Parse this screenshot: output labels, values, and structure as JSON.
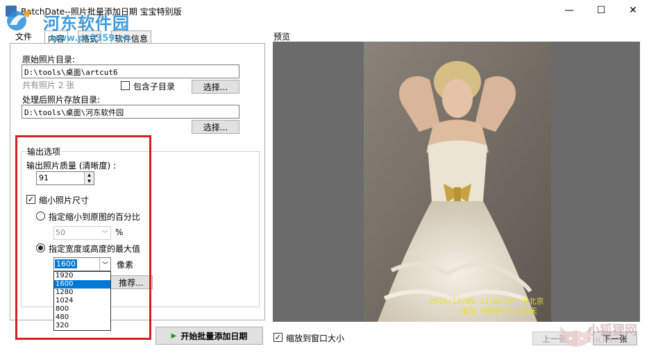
{
  "window": {
    "title": "BatchDate--照片批量添加日期 宝宝特别版",
    "minimize_glyph": "—",
    "maximize_glyph": "☐",
    "close_glyph": "✕"
  },
  "watermark": {
    "site_name": "河东软件园",
    "site_url": "www.pc0359.cn",
    "corner_name": "小狐狸网",
    "corner_url": "XHLKS.CN"
  },
  "menu": {
    "file": "文件"
  },
  "tabs": [
    {
      "label": "内容",
      "active": true
    },
    {
      "label": "格式",
      "active": false
    },
    {
      "label": "软件信息",
      "active": false
    }
  ],
  "source": {
    "label": "原始照片目录:",
    "path": "D:\\tools\\桌面\\artcut6",
    "count_text": "共有照片 2 张",
    "include_subdirs_label": "包含子目录",
    "include_subdirs_checked": false,
    "browse_label": "选择..."
  },
  "output_dir": {
    "label": "处理后照片存放目录:",
    "path": "D:\\tools\\桌面\\河东软件园",
    "browse_label": "选择..."
  },
  "output_options": {
    "group_label": "输出选项",
    "quality_label": "输出照片质量 (清晰度) :",
    "quality_value": "91",
    "shrink_label": "缩小照片尺寸",
    "shrink_checked": true,
    "percent_option_label": "指定缩小到原图的百分比",
    "percent_selected": false,
    "percent_value": "50",
    "percent_unit": "%",
    "maxsize_option_label": "指定宽度或高度的最大值",
    "maxsize_selected": true,
    "maxsize_value": "1600",
    "maxsize_unit": "像素",
    "recommend_label": "推荐...",
    "maxsize_options": [
      "1920",
      "1600",
      "1280",
      "1024",
      "800",
      "480",
      "320"
    ],
    "maxsize_selected_index": 1
  },
  "start_button_label": "开始批量添加日期",
  "preview": {
    "label": "预览",
    "stamp_line1": "2016/12/09 13:03:01 于北京",
    "stamp_line2": "宝宝 9周岁4个月16天",
    "fit_window_label": "缩放到窗口大小",
    "fit_window_checked": true,
    "prev_label": "上一张",
    "next_label": "下一张"
  },
  "colors": {
    "highlight_red": "#d42020",
    "selection_blue": "#0078d7",
    "stamp_yellow": "#e8e020",
    "preview_bg": "#6b6b6b"
  }
}
